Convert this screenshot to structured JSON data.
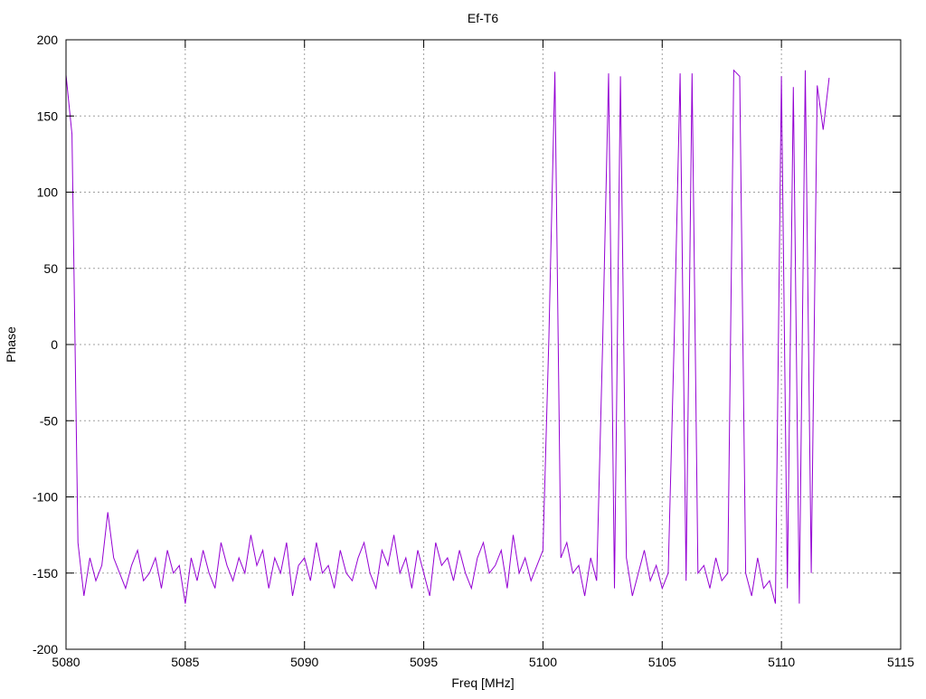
{
  "chart_data": {
    "type": "line",
    "title": "Ef-T6",
    "xlabel": "Freq [MHz]",
    "ylabel": "Phase",
    "xlim": [
      5080,
      5115
    ],
    "ylim": [
      -200,
      200
    ],
    "xticks": [
      5080,
      5085,
      5090,
      5095,
      5100,
      5105,
      5110,
      5115
    ],
    "yticks": [
      -200,
      -150,
      -100,
      -50,
      0,
      50,
      100,
      150,
      200
    ],
    "grid": true,
    "x_start": 5080,
    "x_step": 0.25,
    "series": [
      {
        "name": "phase",
        "color": "#9400d3",
        "values": [
          177,
          138,
          -130,
          -165,
          -140,
          -155,
          -145,
          -110,
          -140,
          -150,
          -160,
          -145,
          -135,
          -155,
          -150,
          -140,
          -160,
          -135,
          -150,
          -145,
          -170,
          -140,
          -155,
          -135,
          -150,
          -160,
          -130,
          -145,
          -155,
          -140,
          -150,
          -125,
          -145,
          -135,
          -160,
          -140,
          -150,
          -130,
          -165,
          -145,
          -140,
          -155,
          -130,
          -150,
          -145,
          -160,
          -135,
          -150,
          -155,
          -140,
          -130,
          -150,
          -160,
          -135,
          -145,
          -125,
          -150,
          -140,
          -160,
          -135,
          -150,
          -165,
          -130,
          -145,
          -140,
          -155,
          -135,
          -150,
          -160,
          -140,
          -130,
          -150,
          -145,
          -135,
          -160,
          -125,
          -150,
          -140,
          -155,
          -145,
          -135,
          5,
          179,
          -140,
          -130,
          -150,
          -145,
          -165,
          -140,
          -155,
          0,
          178,
          -160,
          176,
          -140,
          -165,
          -150,
          -135,
          -155,
          -145,
          -160,
          -150,
          2,
          178,
          -155,
          178,
          -150,
          -145,
          -160,
          -140,
          -155,
          -150,
          180,
          176,
          -150,
          -165,
          -140,
          -160,
          -155,
          -170,
          176,
          -160,
          169,
          -170,
          180,
          -150,
          170,
          141,
          175
        ]
      }
    ]
  }
}
